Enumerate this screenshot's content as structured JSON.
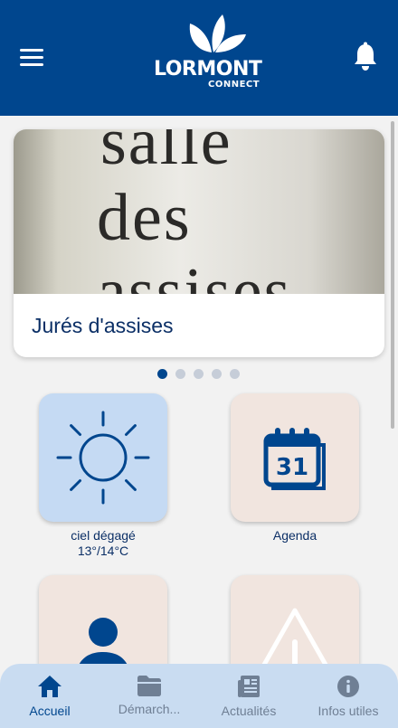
{
  "header": {
    "logo_title": "LORMONT",
    "logo_subtitle": "CONNECT"
  },
  "carousel": {
    "photo_text": [
      "salle",
      "des",
      "assises"
    ],
    "title": "Jurés d'assises",
    "pages": 5,
    "active_page": 1
  },
  "tiles": [
    {
      "label_line1": "ciel dégagé",
      "label_line2": "13°/14°C",
      "icon": "sun-icon",
      "color": "#c5daf3"
    },
    {
      "label": "Agenda",
      "icon": "calendar-icon",
      "icon_text": "31",
      "color": "#f1e5df"
    },
    {
      "icon": "person-laptop-icon",
      "color": "#f1e5df"
    },
    {
      "icon": "warning-icon",
      "color": "#f1e5df"
    }
  ],
  "bottom_nav": [
    {
      "label": "Accueil",
      "icon": "home-icon",
      "active": true
    },
    {
      "label": "Démarch...",
      "icon": "folder-icon",
      "active": false
    },
    {
      "label": "Actualités",
      "icon": "newspaper-icon",
      "active": false
    },
    {
      "label": "Infos utiles",
      "icon": "info-icon",
      "active": false
    }
  ],
  "colors": {
    "primary": "#00468e",
    "tile_blue": "#c5daf3",
    "tile_beige": "#f1e5df",
    "nav_background": "#c9dcf1"
  }
}
